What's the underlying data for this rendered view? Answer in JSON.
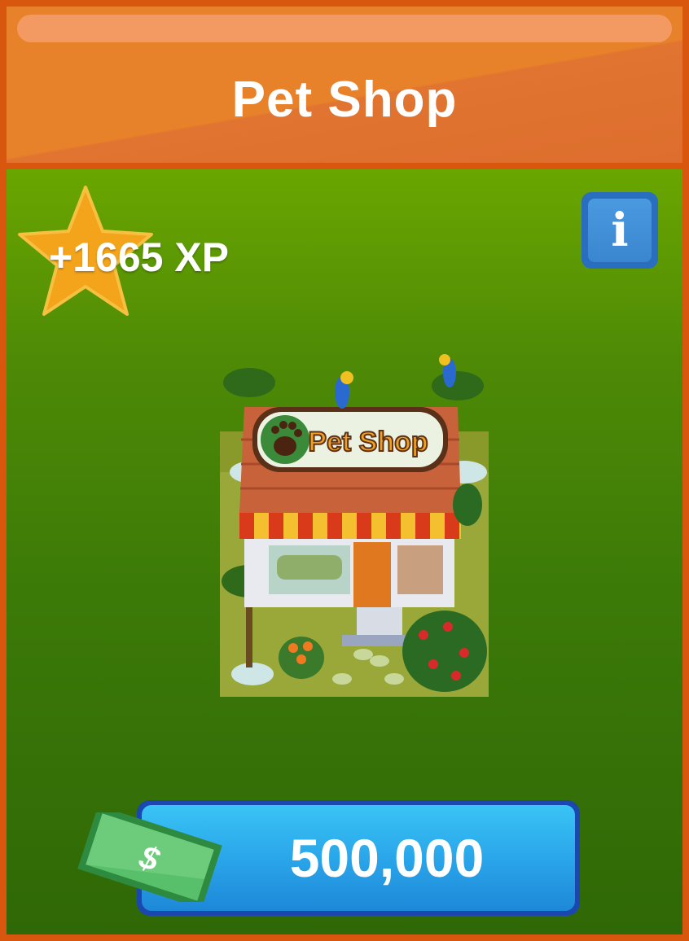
{
  "header": {
    "title": "Pet Shop"
  },
  "reward": {
    "xp_label": "+1665 XP",
    "icon": "star-icon"
  },
  "info_button": {
    "label": "i",
    "icon": "info-icon"
  },
  "item": {
    "image": "pet-shop-building",
    "sign_text": "Pet Shop"
  },
  "purchase": {
    "price": "500,000",
    "currency_icon": "cash-bill-icon",
    "currency_symbol": "$"
  },
  "colors": {
    "header": "#e8822a",
    "border": "#d8560e",
    "body_top": "#6aa600",
    "body_bottom": "#2f6806",
    "button": "#2aa6ea",
    "star": "#f4a41a"
  }
}
